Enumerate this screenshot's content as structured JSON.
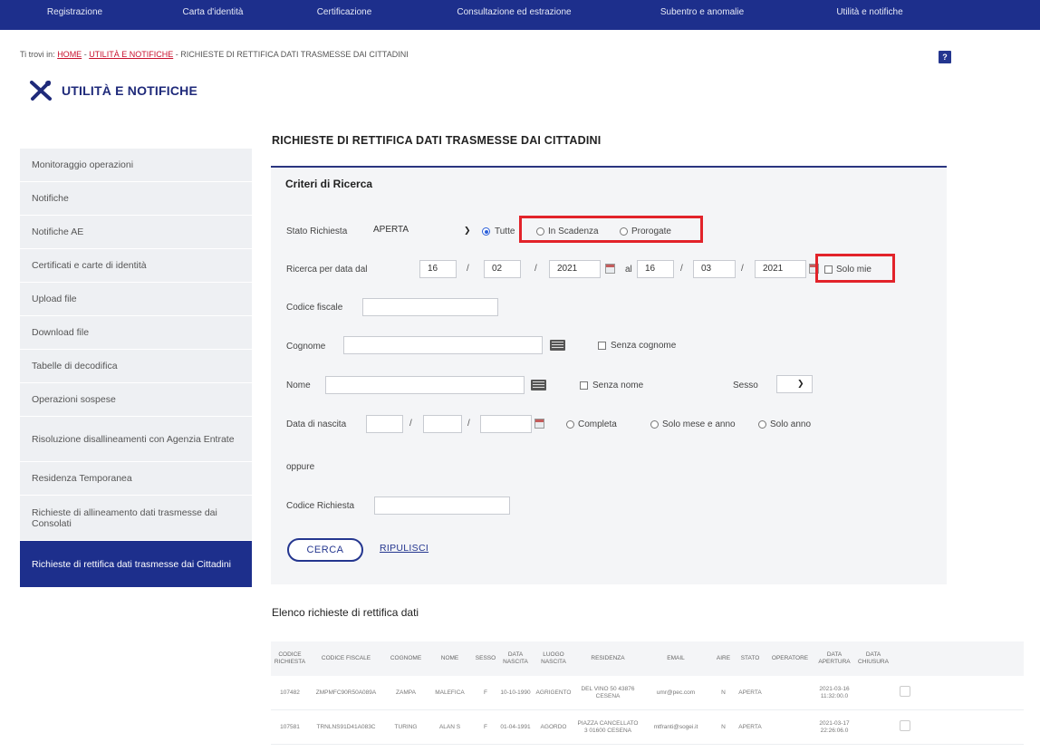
{
  "topnav": [
    "Registrazione",
    "Carta d'identità",
    "Certificazione",
    "Consultazione ed estrazione",
    "Subentro e anomalie",
    "Utilità e notifiche"
  ],
  "breadcrumb": {
    "prefix": "Ti trovi in:",
    "home": "HOME",
    "sep": " - ",
    "section": "UTILITÀ E NOTIFICHE",
    "current": "RICHIESTE DI RETTIFICA DATI TRASMESSE DAI CITTADINI"
  },
  "help_label": "?",
  "section_title": "UTILITÀ E NOTIFICHE",
  "sidebar": {
    "items": [
      {
        "label": "Monitoraggio operazioni"
      },
      {
        "label": "Notifiche"
      },
      {
        "label": "Notifiche AE"
      },
      {
        "label": "Certificati e carte di identità"
      },
      {
        "label": "Upload file"
      },
      {
        "label": "Download file"
      },
      {
        "label": "Tabelle di decodifica"
      },
      {
        "label": "Operazioni sospese"
      },
      {
        "label": "Risoluzione disallineamenti con Agenzia Entrate"
      },
      {
        "label": "Residenza Temporanea"
      },
      {
        "label": "Richieste di allineamento dati trasmesse dai Consolati"
      },
      {
        "label": "Richieste di rettifica dati trasmesse dai Cittadini"
      }
    ]
  },
  "page_title": "RICHIESTE DI RETTIFICA DATI TRASMESSE DAI CITTADINI",
  "form": {
    "title": "Criteri di Ricerca",
    "stato_label": "Stato Richiesta",
    "stato_value": "APERTA",
    "radio_tutte": "Tutte",
    "radio_scadenza": "In Scadenza",
    "radio_prorogate": "Prorogate",
    "data_label": "Ricerca per data dal",
    "dal_gg": "16",
    "dal_mm": "02",
    "dal_aaaa": "2021",
    "al_label": "al",
    "al_gg": "16",
    "al_mm": "03",
    "al_aaaa": "2021",
    "solo_mie": "Solo mie",
    "cf_label": "Codice fiscale",
    "cognome_label": "Cognome",
    "senza_cognome": "Senza cognome",
    "nome_label": "Nome",
    "senza_nome": "Senza nome",
    "sesso_label": "Sesso",
    "nascita_label": "Data di nascita",
    "opt_completa": "Completa",
    "opt_mese_anno": "Solo mese e anno",
    "opt_anno": "Solo anno",
    "oppure": "oppure",
    "codice_label": "Codice Richiesta",
    "cerca": "CERCA",
    "ripulisci": "RIPULISCI",
    "slash": "/"
  },
  "list_title": "Elenco richieste di rettifica dati",
  "table": {
    "headers": [
      "CODICE RICHIESTA",
      "CODICE FISCALE",
      "COGNOME",
      "NOME",
      "SESSO",
      "DATA NASCITA",
      "LUOGO NASCITA",
      "RESIDENZA",
      "EMAIL",
      "AIRE",
      "STATO",
      "OPERATORE",
      "DATA APERTURA",
      "DATA CHIUSURA"
    ],
    "rows": [
      [
        "107482",
        "ZMPMFC90R50A089A",
        "ZAMPA",
        "MALEFICA",
        "F",
        "10-10-1990",
        "AGRIGENTO",
        "DEL VINO 50 43876 CESENA",
        "umr@pec.com",
        "N",
        "APERTA",
        "",
        "2021-03-16 11:32:00.0",
        ""
      ],
      [
        "107581",
        "TRNLNS91D41A083C",
        "TURING",
        "ALAN S",
        "F",
        "01-04-1991",
        "AGORDO",
        "PIAZZA CANCELLATO 3 01600 CESENA",
        "mtfranti@sogei.it",
        "N",
        "APERTA",
        "",
        "2021-03-17 22:26:06.0",
        ""
      ]
    ]
  }
}
